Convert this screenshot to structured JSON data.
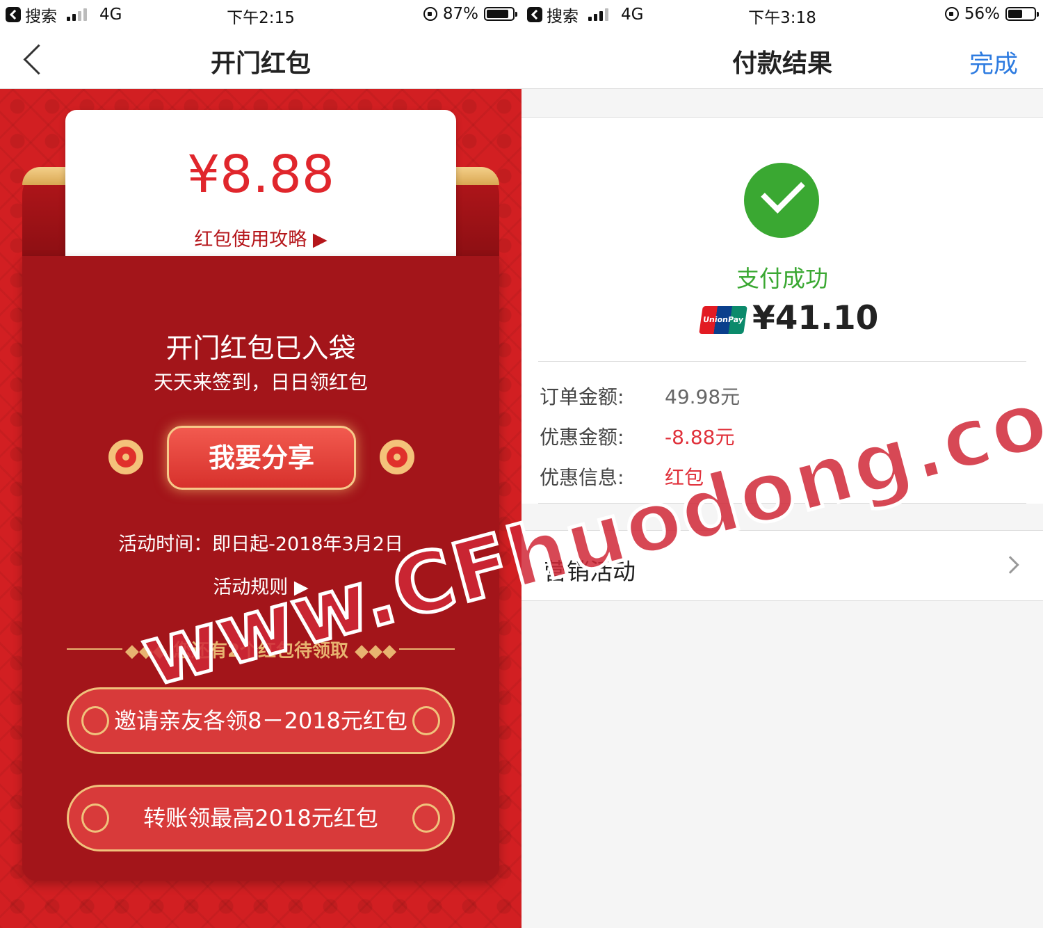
{
  "left": {
    "status": {
      "app_back": "搜索",
      "network": "4G",
      "time": "下午2:15",
      "battery": "87%",
      "battery_level": 0.87
    },
    "nav": {
      "title": "开门红包"
    },
    "card": {
      "amount": "¥8.88",
      "guide_link": "红包使用攻略 ▶"
    },
    "envelope": {
      "title": "开门红包已入袋",
      "subtitle": "天天来签到，日日领红包",
      "share_button": "我要分享",
      "activity_time": "活动时间：即日起-2018年3月2日",
      "rules_link": "活动规则 ▶",
      "remaining": "◆◆◆ 您还有2个红包待领取 ◆◆◆",
      "offers": [
        "邀请亲友各领8－2018元红包",
        "转账领最高2018元红包"
      ]
    }
  },
  "right": {
    "status": {
      "app_back": "搜索",
      "network": "4G",
      "time": "下午3:18",
      "battery": "56%",
      "battery_level": 0.56
    },
    "nav": {
      "title": "付款结果",
      "done": "完成"
    },
    "result": {
      "status_text": "支付成功",
      "card_brand": "UnionPay 银联",
      "amount": "¥41.10"
    },
    "details": [
      {
        "label": "订单金额:",
        "value": "49.98元",
        "color": "#666666"
      },
      {
        "label": "优惠金额:",
        "value": "-8.88元",
        "color": "#e0303a"
      },
      {
        "label": "优惠信息:",
        "value": "红包",
        "color": "#e0303a"
      }
    ],
    "marketing": {
      "label": "营销活动"
    }
  },
  "watermark": "www.CFhuodong.com"
}
